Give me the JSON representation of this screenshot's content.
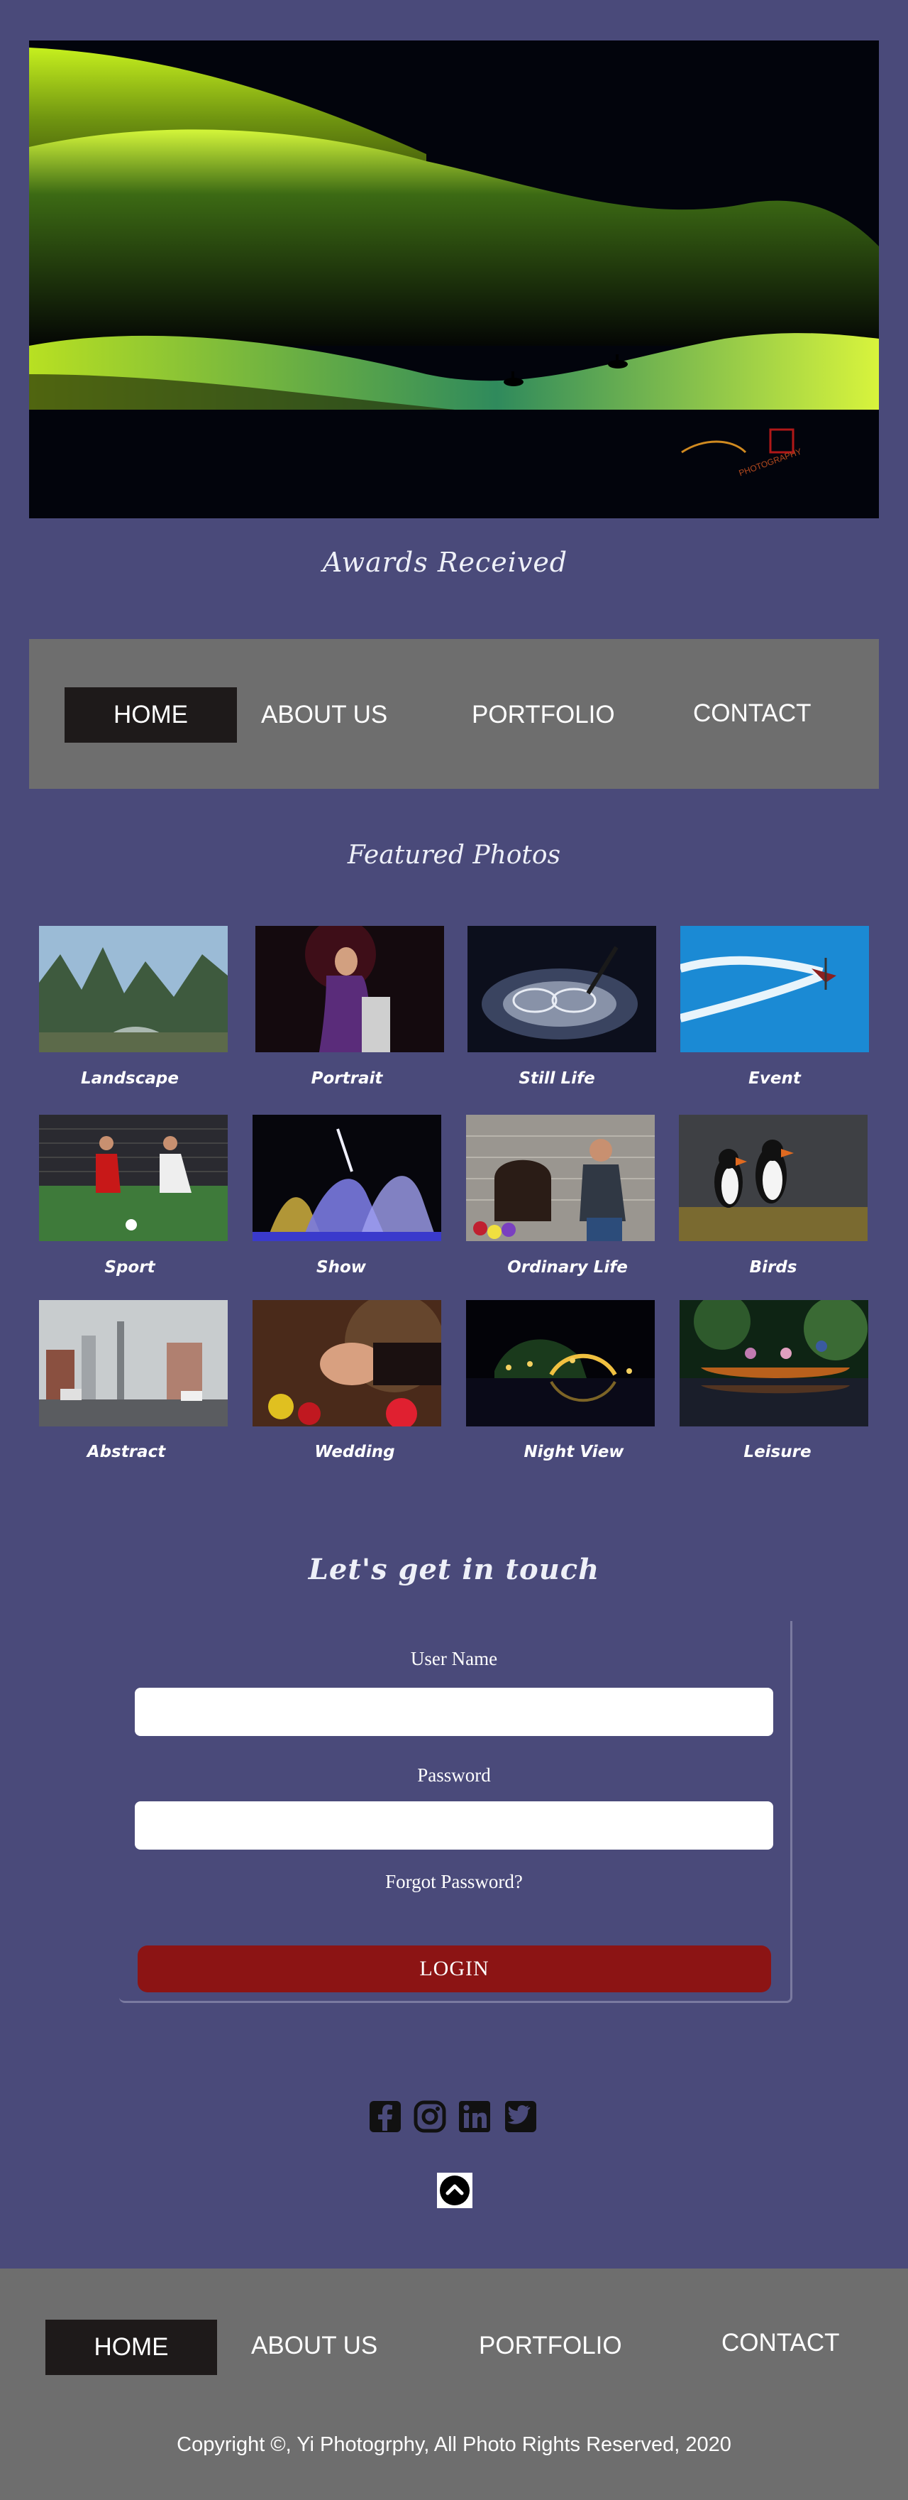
{
  "hero": {
    "logo_text": "PHOTOGRAPHY"
  },
  "awards": {
    "label": "Awards Received"
  },
  "nav": {
    "items": [
      {
        "label": "HOME"
      },
      {
        "label": "ABOUT US"
      },
      {
        "label": "PORTFOLIO"
      },
      {
        "label": "CONTACT"
      }
    ]
  },
  "featured": {
    "title": "Featured Photos",
    "photos": [
      {
        "caption": "Landscape"
      },
      {
        "caption": "Portrait"
      },
      {
        "caption": "Still Life"
      },
      {
        "caption": "Event"
      },
      {
        "caption": "Sport"
      },
      {
        "caption": "Show"
      },
      {
        "caption": "Ordinary  Life"
      },
      {
        "caption": "Birds"
      },
      {
        "caption": "Abstract"
      },
      {
        "caption": "Wedding"
      },
      {
        "caption": "Night View"
      },
      {
        "caption": "Leisure"
      }
    ]
  },
  "contact": {
    "title": "Let's get in touch",
    "username_label": "User Name",
    "username_value": "",
    "password_label": "Password",
    "password_value": "",
    "forgot_label": "Forgot Password?",
    "login_label": "LOGIN"
  },
  "social": {
    "icons": [
      "facebook-icon",
      "instagram-icon",
      "linkedin-icon",
      "twitter-icon"
    ]
  },
  "footer": {
    "nav": [
      {
        "label": "HOME"
      },
      {
        "label": "ABOUT US"
      },
      {
        "label": "PORTFOLIO"
      },
      {
        "label": "CONTACT"
      }
    ],
    "copyright": "Copyright ©, Yi Photogrphy, All Photo Rights Reserved, 2020"
  },
  "colors": {
    "background": "#4a4a7a",
    "nav_bg": "#6e6e6e",
    "active_nav": "#1e1a1a",
    "login_button": "#8c1414"
  }
}
